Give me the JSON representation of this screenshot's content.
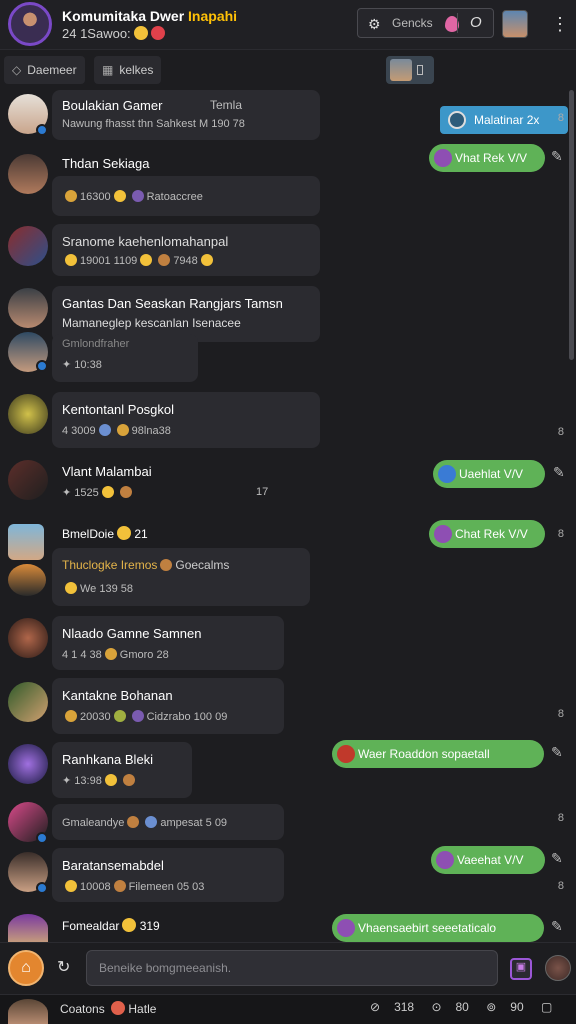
{
  "header": {
    "title_main": "Komumitaka Dwer ",
    "title_accent": "Inapahi",
    "subtitle": "24 1Sawoo:",
    "search_label": "Gencks",
    "search_icon": "gear-icon",
    "menu_icon": "kebab-menu-icon"
  },
  "subbar": {
    "chip1": "Daemeer",
    "chip2": "kelkes",
    "channel_button": "Malatinar 2x"
  },
  "chats": [
    {
      "name": "Boulakian Gamer",
      "tag": "Temla",
      "line": "Nawung fhasst thn Sahkest M",
      "time": "190 78"
    },
    {
      "name": "Thdan Sekiaga",
      "line": "16300",
      "extra": "Ratoaccree"
    },
    {
      "name": "Sranome kaehenlomahanpal",
      "line": "19001 1109",
      "extra": "7948"
    },
    {
      "name": "Gantas Dan Seaskan Rangjars Tamsn",
      "line": "Mamaneglep kescanlan Isenacee"
    },
    {
      "name": "Gmlondfraher",
      "line": "10:38"
    },
    {
      "name": "Kentontanl Posgkol",
      "line": "4 3009",
      "extra": "98lna38"
    },
    {
      "name": "Vlant Malambai",
      "line": "1525",
      "extra": "17"
    },
    {
      "name": "BmelDoie",
      "count": "21"
    },
    {
      "name": "Thuclogke Iremos",
      "extra": "Goecalms",
      "line2": "We 139",
      "num": "58"
    },
    {
      "name": "Nlaado Gamne Samnen",
      "line": "4 1 4 38",
      "extra": "Gmoro",
      "num": "28"
    },
    {
      "name": "Kantakne Bohanan",
      "line": "20030",
      "extra": "Cidzrabo 100 09"
    },
    {
      "name": "Ranhkana Bleki",
      "line": "13:98"
    },
    {
      "name": "Gmaleandye",
      "extra": "ampesat",
      "num": "5 09"
    },
    {
      "name": "Baratansemabdel",
      "line": "10008",
      "extra": "Filemeen 05 03"
    },
    {
      "name": "Fomealdar",
      "count": "319"
    }
  ],
  "actions": [
    {
      "label": "Vhat Rek V/V"
    },
    {
      "label": "Uaehlat V/V"
    },
    {
      "label": "Chat Rek V/V"
    },
    {
      "label": "Waer Roaddon sopaetall"
    },
    {
      "label": "Vaeehat V/V"
    },
    {
      "label": "Vhaensaebirt seeetaticalo"
    }
  ],
  "right_numbers": {
    "r1": "8",
    "r2": "8",
    "r3": "8",
    "r4": "8",
    "r5": "8",
    "r6": "8",
    "r7": "8",
    "r8": "8"
  },
  "composer": {
    "placeholder": "Beneike bomgmeeanish."
  },
  "bottombar": {
    "label": "Coatons",
    "label2": "Hatle",
    "n1": "318",
    "n2": "80",
    "n3": "90"
  }
}
